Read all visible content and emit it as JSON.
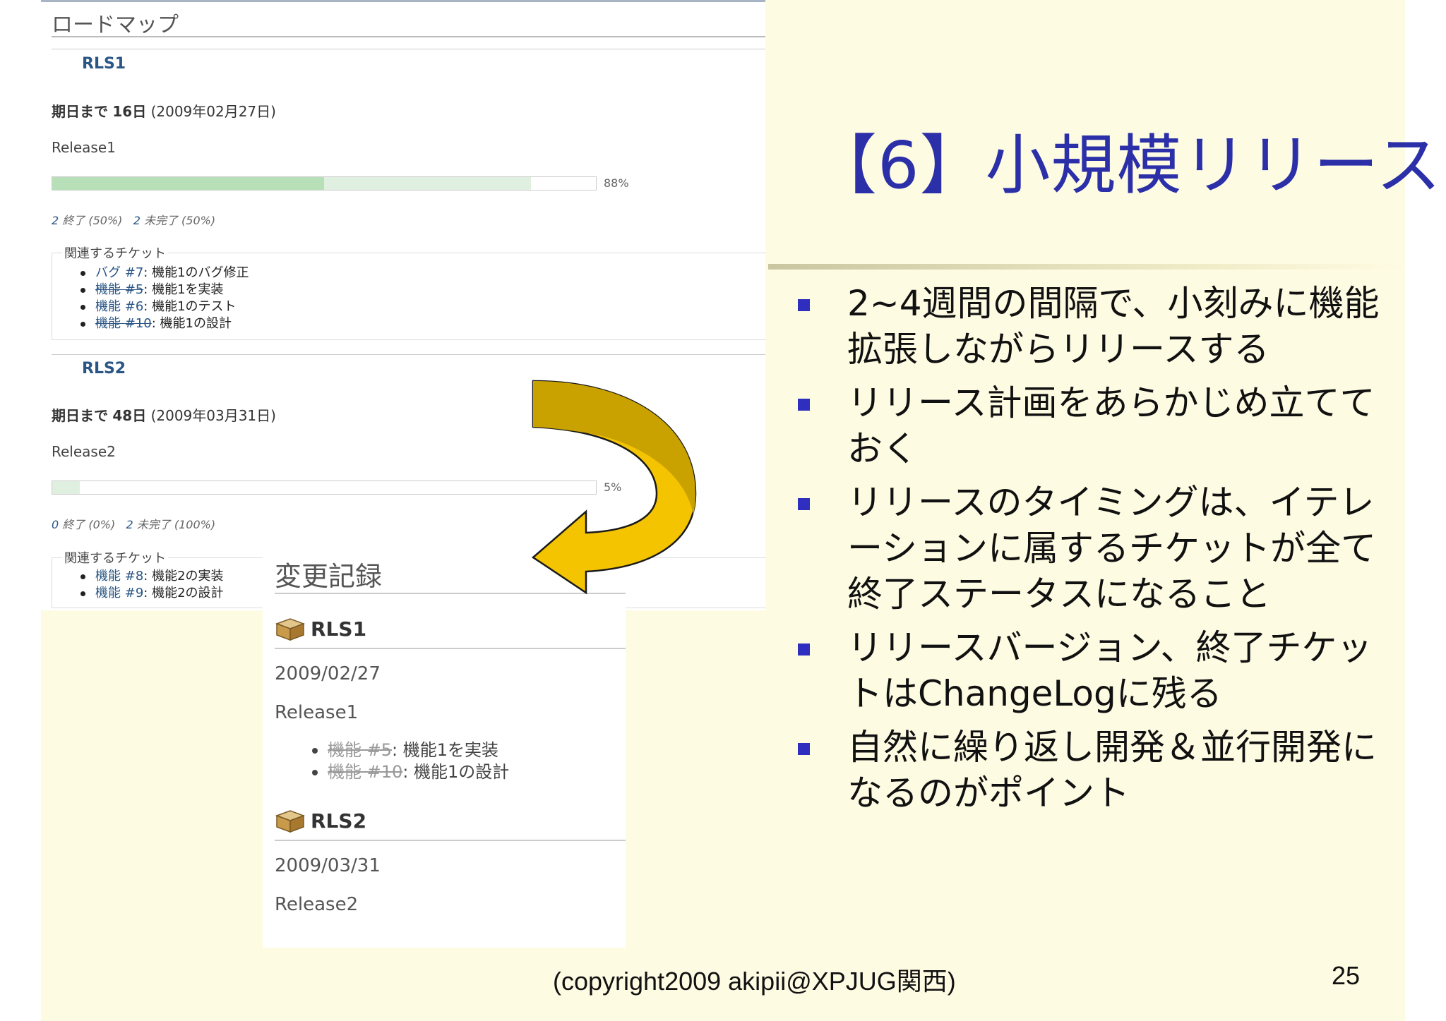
{
  "slide": {
    "title": "【6】小規模リリース",
    "bullets": [
      "2~4週間の間隔で、小刻みに機能拡張しながらリリースする",
      "リリース計画をあらかじめ立てておく",
      "リリースのタイミングは、イテレーションに属するチケットが全て終了ステータスになること",
      "リリースバージョン、終了チケットはChangeLogに残る",
      "自然に繰り返し開発＆並行開発になるのがポイント"
    ],
    "footer": "(copyright2009 akipii@XPJUG関西)",
    "page_number": "25",
    "colors": {
      "background": "#fefbe3",
      "title": "#2b2fa8",
      "bullet": "#2f2fbf",
      "arrow": "#f5c400"
    }
  },
  "roadmap": {
    "heading": "ロードマップ",
    "versions": [
      {
        "name": "RLS1",
        "due_prefix": "期日まで",
        "due_days": "16日",
        "due_date": "(2009年02月27日)",
        "description": "Release1",
        "progress_closed": 0.5,
        "progress_done": 0.88,
        "percent": "88%",
        "closed_count": "2",
        "closed_label": "終了 (50%)",
        "open_count": "2",
        "open_label": "未完了 (50%)",
        "related_label": "関連するチケット",
        "tickets": [
          {
            "tracker": "バグ",
            "number": "#7",
            "subject": ": 機能1のバグ修正",
            "closed": false
          },
          {
            "tracker": "機能",
            "number": "#5",
            "subject": ": 機能1を実装",
            "closed": true
          },
          {
            "tracker": "機能",
            "number": "#6",
            "subject": ": 機能1のテスト",
            "closed": false
          },
          {
            "tracker": "機能",
            "number": "#10",
            "subject": ": 機能1の設計",
            "closed": true
          }
        ]
      },
      {
        "name": "RLS2",
        "due_prefix": "期日まで",
        "due_days": "48日",
        "due_date": "(2009年03月31日)",
        "description": "Release2",
        "progress_closed": 0,
        "progress_done": 0.05,
        "percent": "5%",
        "closed_count": "0",
        "closed_label": "終了 (0%)",
        "open_count": "2",
        "open_label": "未完了 (100%)",
        "related_label": "関連するチケット",
        "tickets": [
          {
            "tracker": "機能",
            "number": "#8",
            "subject": ": 機能2の実装",
            "closed": false
          },
          {
            "tracker": "機能",
            "number": "#9",
            "subject": ": 機能2の設計",
            "closed": false
          }
        ]
      }
    ]
  },
  "changelog": {
    "heading": "変更記録",
    "versions": [
      {
        "name": "RLS1",
        "date": "2009/02/27",
        "description": "Release1",
        "tickets": [
          {
            "label": "機能 #5",
            "subject": ": 機能1を実装"
          },
          {
            "label": "機能 #10",
            "subject": ": 機能1の設計"
          }
        ]
      },
      {
        "name": "RLS2",
        "date": "2009/03/31",
        "description": "Release2"
      }
    ],
    "icon": "package-box-icon"
  }
}
